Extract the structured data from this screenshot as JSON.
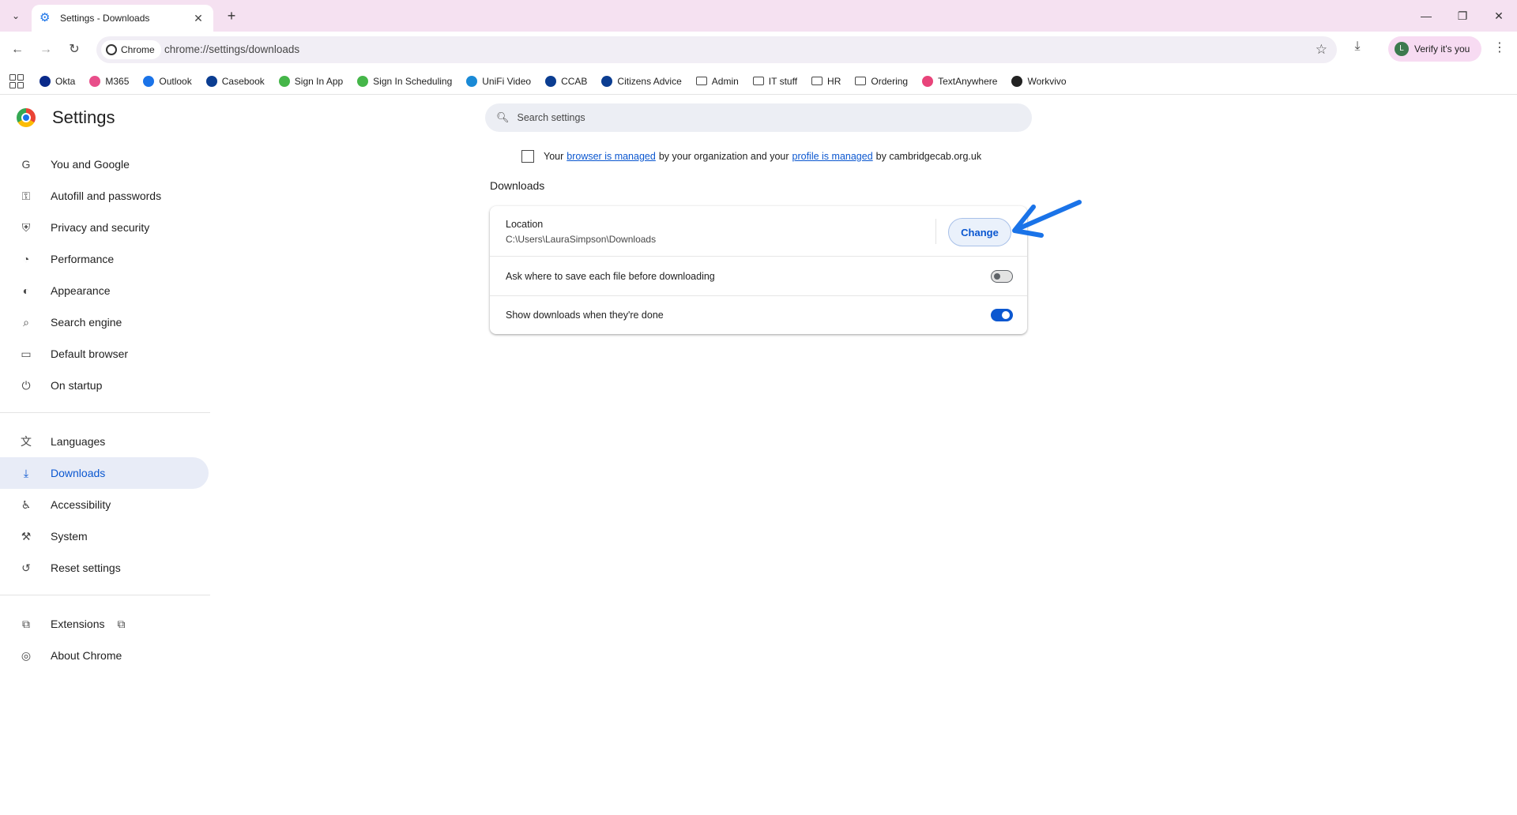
{
  "browser": {
    "tab_title": "Settings - Downloads",
    "chip_label": "Chrome",
    "url": "chrome://settings/downloads",
    "profile_label": "Verify it's you",
    "profile_initial": "L"
  },
  "bookmarks": [
    {
      "label": "Okta",
      "color": "#0a2a8a"
    },
    {
      "label": "M365",
      "color": "#e84e8a"
    },
    {
      "label": "Outlook",
      "color": "#1a73e8"
    },
    {
      "label": "Casebook",
      "color": "#0b3d91"
    },
    {
      "label": "Sign In App",
      "color": "#45b649"
    },
    {
      "label": "Sign In Scheduling",
      "color": "#45b649"
    },
    {
      "label": "UniFi Video",
      "color": "#1a8ad6"
    },
    {
      "label": "CCAB",
      "color": "#0b3d91"
    },
    {
      "label": "Citizens Advice",
      "color": "#0b3d91"
    },
    {
      "label": "Admin",
      "folder": true
    },
    {
      "label": "IT stuff",
      "folder": true
    },
    {
      "label": "HR",
      "folder": true
    },
    {
      "label": "Ordering",
      "folder": true
    },
    {
      "label": "TextAnywhere",
      "color": "#e8447a"
    },
    {
      "label": "Workvivo",
      "color": "#222222"
    }
  ],
  "settings": {
    "title": "Settings",
    "search_placeholder": "Search settings",
    "nav": [
      {
        "label": "You and Google",
        "icon": "G"
      },
      {
        "label": "Autofill and passwords",
        "icon": "⚿"
      },
      {
        "label": "Privacy and security",
        "icon": "⛨"
      },
      {
        "label": "Performance",
        "icon": "◔"
      },
      {
        "label": "Appearance",
        "icon": "◐"
      },
      {
        "label": "Search engine",
        "icon": "⌕"
      },
      {
        "label": "Default browser",
        "icon": "▭"
      },
      {
        "label": "On startup",
        "icon": "⏻"
      }
    ],
    "nav2": [
      {
        "label": "Languages",
        "icon": "文"
      },
      {
        "label": "Downloads",
        "icon": "⤓",
        "active": true
      },
      {
        "label": "Accessibility",
        "icon": "♿"
      },
      {
        "label": "System",
        "icon": "⚒"
      },
      {
        "label": "Reset settings",
        "icon": "↺"
      }
    ],
    "nav3": [
      {
        "label": "Extensions",
        "icon": "⧉"
      },
      {
        "label": "About Chrome",
        "icon": "◎"
      }
    ],
    "managed": {
      "prefix": "Your",
      "link1": "browser is managed",
      "middle": "by your organization and your",
      "link2": "profile is managed",
      "suffix": "by cambridgecab.org.uk"
    },
    "section_title": "Downloads",
    "location_label": "Location",
    "location_path": "C:\\Users\\LauraSimpson\\Downloads",
    "change_label": "Change",
    "ask_label": "Ask where to save each file before downloading",
    "ask_on": false,
    "show_label": "Show downloads when they're done",
    "show_on": true
  }
}
